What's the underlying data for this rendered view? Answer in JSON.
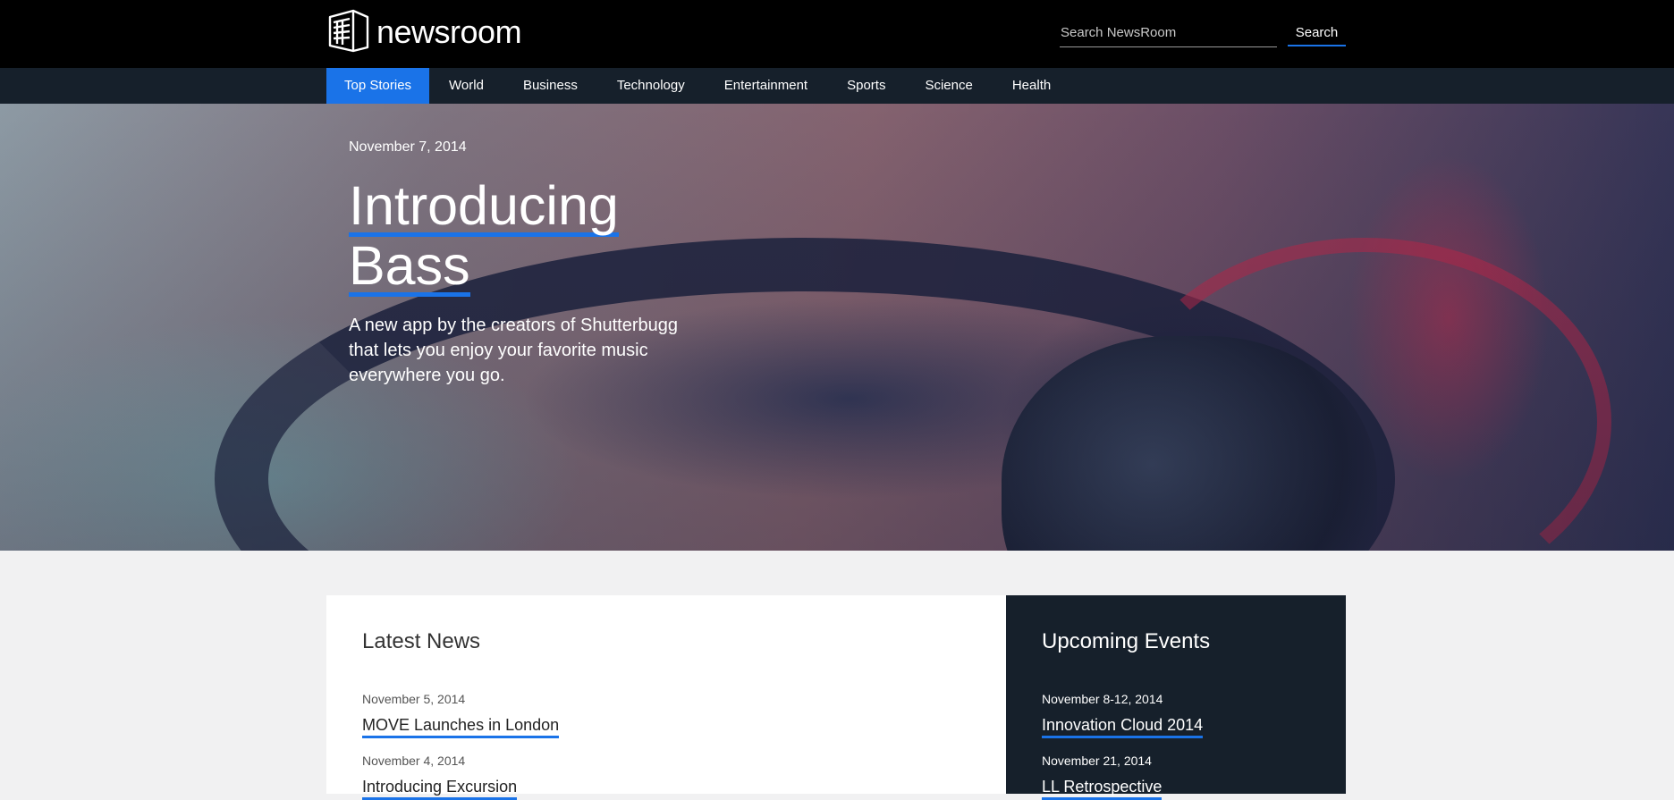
{
  "header": {
    "logo_text": "newsroom",
    "search": {
      "placeholder": "Search NewsRoom",
      "button_label": "Search"
    },
    "colors": {
      "background": "#000000",
      "accent": "#1a73e8"
    }
  },
  "nav": {
    "items": [
      {
        "label": "Top Stories",
        "active": true
      },
      {
        "label": "World"
      },
      {
        "label": "Business"
      },
      {
        "label": "Technology"
      },
      {
        "label": "Entertainment"
      },
      {
        "label": "Sports"
      },
      {
        "label": "Science"
      },
      {
        "label": "Health"
      }
    ]
  },
  "hero": {
    "date": "November 7, 2014",
    "title_line1": "Introducing",
    "title_line2": "Bass",
    "description": "A new app by the creators of Shutterbugg that lets you enjoy your favorite music everywhere you go."
  },
  "latest_news": {
    "heading": "Latest News",
    "items": [
      {
        "date": "November 5, 2014",
        "title": "MOVE Launches in London"
      },
      {
        "date": "November 4, 2014",
        "title": "Introducing Excursion"
      }
    ]
  },
  "upcoming_events": {
    "heading": "Upcoming Events",
    "items": [
      {
        "date": "November 8-12, 2014",
        "title": "Innovation Cloud 2014"
      },
      {
        "date": "November 21, 2014",
        "title": "LL Retrospective"
      }
    ]
  }
}
